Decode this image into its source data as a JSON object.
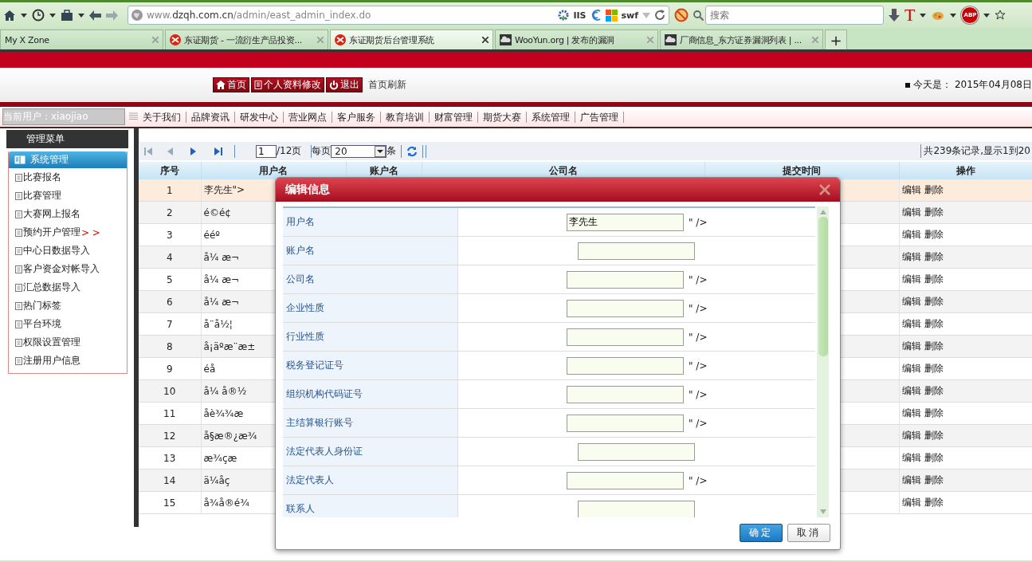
{
  "browser": {
    "url_prefix": "www.",
    "url_domain": "dzqh.com.cn",
    "url_path": "/admin/east_admin_index.do",
    "iis_label": "IIS",
    "swf_label": "swf",
    "search": {
      "placeholder": "搜索"
    },
    "t_label": "T",
    "abp_label": "ABP",
    "tabs": [
      {
        "label": "My X Zone",
        "selected": false,
        "kind": "plain"
      },
      {
        "label": "东证期货 - 一流衍生产品投资...",
        "selected": false,
        "kind": "logo"
      },
      {
        "label": "东证期货后台管理系统",
        "selected": true,
        "kind": "logo"
      },
      {
        "label": "WooYun.org | 发布的漏洞",
        "selected": false,
        "kind": "cloud"
      },
      {
        "label": "厂商信息_东方证券漏洞列表 | ...",
        "selected": false,
        "kind": "cloud"
      }
    ],
    "new_tab": "+"
  },
  "header": {
    "buttons": [
      {
        "label": "首页",
        "kind": "home"
      },
      {
        "label": "个人资料修改",
        "kind": "doc"
      },
      {
        "label": "退出",
        "kind": "power"
      }
    ],
    "refresh_link": "首页刷新",
    "date": "今天是： 2015年04月08日"
  },
  "current_user": "当前用户：xiaojiao",
  "nav_menu": [
    "关于我们",
    "品牌资讯",
    "研发中心",
    "营业网点",
    "客户服务",
    "教育培训",
    "财富管理",
    "期货大赛",
    "系统管理",
    "广告管理"
  ],
  "sidebar": {
    "title": "管理菜单",
    "section": "系统管理",
    "items": [
      {
        "label": "比赛报名"
      },
      {
        "label": "比赛管理"
      },
      {
        "label": "大赛网上报名"
      },
      {
        "label": "预约开户管理",
        "marker": "> >"
      },
      {
        "label": "中心日数据导入"
      },
      {
        "label": "客户资金对帐导入"
      },
      {
        "label": "汇总数据导入"
      },
      {
        "label": "热门标签"
      },
      {
        "label": "平台环境"
      },
      {
        "label": "权限设置管理"
      },
      {
        "label": "注册用户信息"
      }
    ]
  },
  "pager": {
    "page": "1",
    "page_total": "/12页",
    "per_page_label": "每页",
    "per_page": "20",
    "per_page_unit": "条",
    "summary": "共239条记录,显示1到20"
  },
  "table": {
    "columns": [
      "序号",
      "用户名",
      "账户名",
      "公司名",
      "提交时间",
      "操作"
    ],
    "rows": [
      {
        "no": "1",
        "username": "李先生\">",
        "selected": true,
        "actions": [
          "编辑",
          "删除"
        ]
      },
      {
        "no": "2",
        "username": "é©é¢",
        "selected": false,
        "actions": [
          "编辑",
          "删除"
        ]
      },
      {
        "no": "3",
        "username": "ééº",
        "selected": false,
        "actions": [
          "编辑",
          "删除"
        ]
      },
      {
        "no": "4",
        "username": "å¼ æ¬",
        "selected": false,
        "actions": [
          "编辑",
          "删除"
        ]
      },
      {
        "no": "5",
        "username": "å¼ æ¬",
        "selected": false,
        "actions": [
          "编辑",
          "删除"
        ]
      },
      {
        "no": "6",
        "username": "å¼ æ¬",
        "selected": false,
        "actions": [
          "编辑",
          "删除"
        ]
      },
      {
        "no": "7",
        "username": "å¨å½¦",
        "selected": false,
        "actions": [
          "编辑",
          "删除"
        ]
      },
      {
        "no": "8",
        "username": "å¡äºæ¨æ±",
        "selected": false,
        "actions": [
          "编辑",
          "删除"
        ]
      },
      {
        "no": "9",
        "username": "éå",
        "selected": false,
        "actions": [
          "编辑",
          "删除"
        ]
      },
      {
        "no": "10",
        "username": "å¼ å®½",
        "selected": false,
        "actions": [
          "编辑",
          "删除"
        ]
      },
      {
        "no": "11",
        "username": "åè¾¾æ",
        "selected": false,
        "actions": [
          "编辑",
          "删除"
        ]
      },
      {
        "no": "12",
        "username": "å§æ®¿æ¾",
        "selected": false,
        "actions": [
          "编辑",
          "删除"
        ]
      },
      {
        "no": "13",
        "username": "æ¾çæ",
        "selected": false,
        "actions": [
          "编辑",
          "删除"
        ]
      },
      {
        "no": "14",
        "username": "ä¼åç",
        "selected": false,
        "actions": [
          "编辑",
          "删除"
        ]
      },
      {
        "no": "15",
        "username": "å¾å®é¾",
        "selected": false,
        "actions": [
          "编辑",
          "删除"
        ]
      }
    ]
  },
  "dialog": {
    "title": "编辑信息",
    "fields": [
      {
        "label": "用户名",
        "kind": "suffixed",
        "value": "李先生",
        "suffix": "\" />"
      },
      {
        "label": "账户名",
        "kind": "plain"
      },
      {
        "label": "公司名",
        "kind": "suffixed",
        "suffix": "\" />"
      },
      {
        "label": "企业性质",
        "kind": "suffixed",
        "suffix": "\" />"
      },
      {
        "label": "行业性质",
        "kind": "suffixed",
        "suffix": "\" />"
      },
      {
        "label": "税务登记证号",
        "kind": "suffixed",
        "suffix": "\" />"
      },
      {
        "label": "组织机构代码证号",
        "kind": "suffixed",
        "suffix": "\" />"
      },
      {
        "label": "主结算银行账号",
        "kind": "suffixed",
        "suffix": "\" />"
      },
      {
        "label": "法定代表人身份证",
        "kind": "plain"
      },
      {
        "label": "法定代表人",
        "kind": "suffixed",
        "suffix": "\" />"
      },
      {
        "label": "联系人",
        "kind": "plain"
      }
    ],
    "ok": "确定",
    "cancel": "取消"
  }
}
